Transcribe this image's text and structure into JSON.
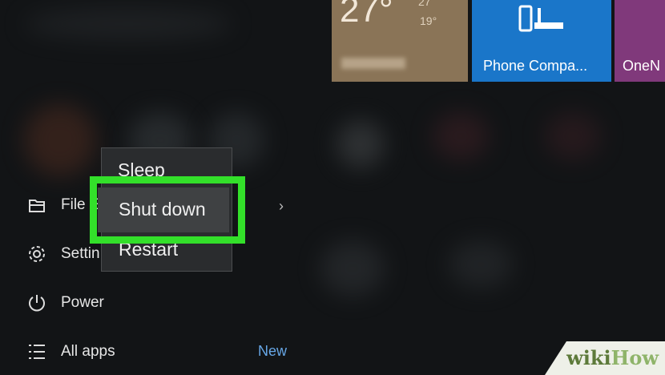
{
  "tiles": {
    "weather": {
      "temp": "27°",
      "high": "27",
      "low": "19°"
    },
    "phone": {
      "label": "Phone Compa...",
      "icon": "phone-companion-icon"
    },
    "onenote": {
      "label": "OneN"
    }
  },
  "power_menu": {
    "items": [
      "Sleep",
      "Shut down",
      "Restart"
    ],
    "highlighted": "Shut down"
  },
  "left_list": [
    {
      "label": "File E",
      "icon": "file-explorer-icon"
    },
    {
      "label": "Settin",
      "icon": "settings-icon"
    },
    {
      "label": "Power",
      "icon": "power-icon"
    },
    {
      "label": "All apps",
      "icon": "all-apps-icon"
    }
  ],
  "badge_new": "New",
  "watermark": {
    "wiki": "wiki",
    "how": "How"
  },
  "colors": {
    "highlight_box": "#33e02a",
    "phone_tile": "#1a76c9",
    "onenote_tile": "#80397b",
    "weather_tile": "#8a7457"
  }
}
